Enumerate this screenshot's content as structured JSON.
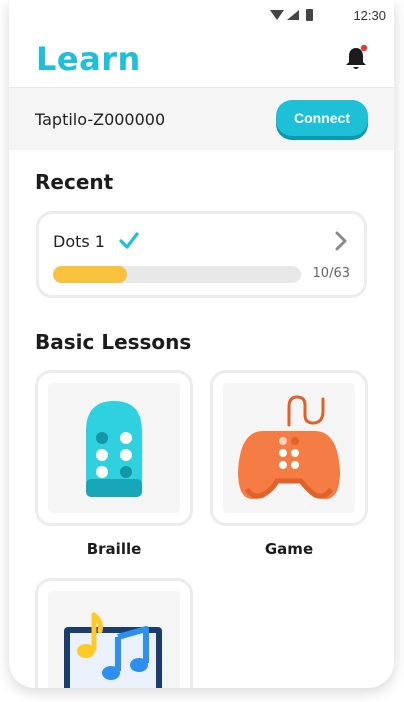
{
  "status_bar": {
    "time": "12:30"
  },
  "header": {
    "title": "Learn"
  },
  "device": {
    "name": "Taptilo-Z000000",
    "connect_label": "Connect"
  },
  "recent": {
    "title": "Recent",
    "lesson": {
      "name": "Dots 1",
      "completed": true,
      "progress_text": "10/63",
      "progress_fraction": 0.3
    }
  },
  "basic_lessons": {
    "title": "Basic Lessons",
    "items": [
      {
        "label": "Braille",
        "icon": "braille-device-icon"
      },
      {
        "label": "Game",
        "icon": "game-controller-icon"
      },
      {
        "label": "",
        "icon": "music-notes-icon"
      }
    ]
  },
  "colors": {
    "accent": "#1ec0d8",
    "progress": "#f9c23c",
    "game": "#f57c45",
    "notification_dot": "#e53935"
  }
}
